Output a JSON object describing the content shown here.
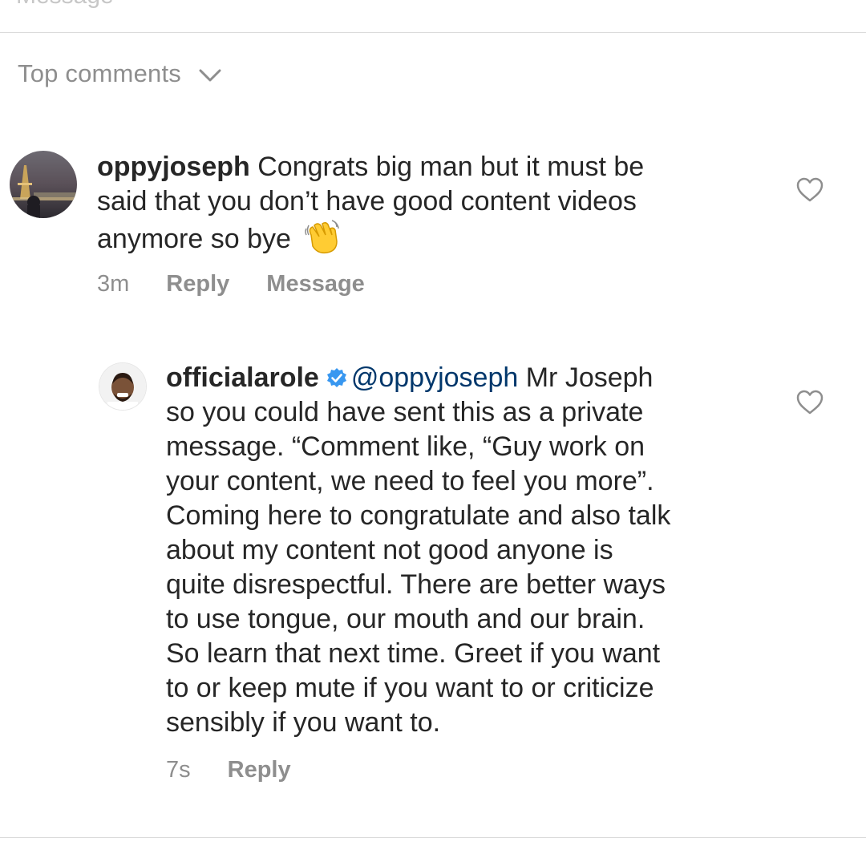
{
  "top_cut_text": "Message",
  "sort": {
    "label": "Top comments"
  },
  "comments": [
    {
      "username": "oppyjoseph",
      "lines": [
        "Congrats big man but it must be",
        "said that you don’t have good content videos",
        "anymore so bye"
      ],
      "emoji": "waving-hand-emoji",
      "time": "3m",
      "reply_label": "Reply",
      "message_label": "Message"
    },
    {
      "username": "officialarole",
      "mention": "@oppyjoseph",
      "lines": [
        "Mr Joseph",
        "so you could have sent this as a private",
        "message. “Comment like, “Guy work on",
        "your content, we need to feel you more”.",
        "Coming here to congratulate and also talk",
        "about my content not good anyone is",
        "quite disrespectful. There are better ways",
        "to use tongue, our mouth and our brain.",
        "So learn that next time. Greet if you want",
        "to or keep mute if you want to or criticize",
        "sensibly if you want to."
      ],
      "time": "7s",
      "reply_label": "Reply"
    }
  ],
  "colors": {
    "text": "#262626",
    "secondary": "#8e8e8e",
    "mention": "#00376b",
    "verified": "#3897f0",
    "divider": "#dbdbdb"
  }
}
